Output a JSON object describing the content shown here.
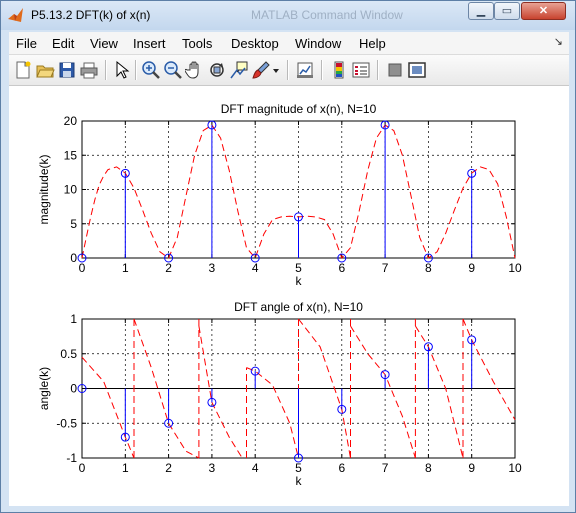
{
  "window": {
    "title": "P5.13.2 DFT(k) of x(n)",
    "background_window_title": "MATLAB Command Window",
    "controls": {
      "minimize": "▁",
      "maximize": "▭",
      "close": "✕"
    }
  },
  "menu": {
    "items": [
      "File",
      "Edit",
      "View",
      "Insert",
      "Tools",
      "Desktop",
      "Window",
      "Help"
    ],
    "dock_arrow": "↘"
  },
  "toolbar": {
    "icons": [
      "new-figure-icon",
      "open-file-icon",
      "save-icon",
      "print-icon",
      "pointer-icon",
      "zoom-in-icon",
      "zoom-out-icon",
      "pan-hand-icon",
      "rotate-3d-icon",
      "data-cursor-icon",
      "brush-icon",
      "brush-dropdown-icon",
      "link-plot-icon",
      "colorbar-icon",
      "legend-icon",
      "hide-plot-tools-icon",
      "show-plot-tools-icon"
    ]
  },
  "colors": {
    "stem": "#0000ff",
    "dashed": "#ff0000",
    "accent_title": "#c3d7ee"
  },
  "chart_data": [
    {
      "type": "stem",
      "title": "DFT magnitude of x(n), N=10",
      "xlabel": "k",
      "ylabel": "magnitude(k)",
      "xlim": [
        0,
        10
      ],
      "ylim": [
        0,
        20
      ],
      "xticks": [
        "0",
        "1",
        "2",
        "3",
        "4",
        "5",
        "6",
        "7",
        "8",
        "9",
        "10"
      ],
      "yticks": [
        "0",
        "5",
        "10",
        "15",
        "20"
      ],
      "grid": true,
      "stem": {
        "k": [
          0,
          1,
          2,
          3,
          4,
          5,
          6,
          7,
          8,
          9
        ],
        "values": [
          0,
          12.36,
          0,
          19.42,
          0,
          6.0,
          0,
          19.42,
          0,
          12.36
        ]
      },
      "continuous_dashed": {
        "description_free": true,
        "x": [
          0,
          0.1,
          0.2,
          0.3,
          0.4,
          0.5,
          0.6,
          0.8,
          1.0,
          1.2,
          1.4,
          1.6,
          1.8,
          2.0,
          2.2,
          2.4,
          2.6,
          2.8,
          3.0,
          3.2,
          3.4,
          3.6,
          3.8,
          4.0,
          4.2,
          4.4,
          4.6,
          4.8,
          5.0,
          5.2,
          5.4,
          5.6,
          5.8,
          6.0,
          6.2,
          6.4,
          6.6,
          6.8,
          7.0,
          7.2,
          7.4,
          7.6,
          7.8,
          8.0,
          8.2,
          8.4,
          8.6,
          8.8,
          9.0,
          9.2,
          9.4,
          9.6,
          9.8,
          10.0
        ],
        "y": [
          0,
          3.0,
          6.0,
          8.6,
          10.7,
          12.0,
          12.9,
          13.3,
          12.4,
          10.2,
          7.0,
          3.6,
          0.9,
          0,
          3.0,
          9.0,
          15.0,
          18.6,
          19.4,
          17.5,
          12.8,
          6.8,
          1.5,
          0,
          3.5,
          5.6,
          6.0,
          6.1,
          6.0,
          6.1,
          6.0,
          5.6,
          3.5,
          0,
          1.5,
          6.8,
          12.8,
          17.5,
          19.4,
          18.6,
          15.0,
          9.0,
          3.0,
          0,
          0.9,
          3.6,
          7.0,
          10.2,
          12.4,
          13.3,
          12.9,
          10.8,
          6.0,
          0
        ]
      }
    },
    {
      "type": "stem",
      "title": "DFT angle of x(n), N=10",
      "xlabel": "k",
      "ylabel": "angle(k)",
      "xlim": [
        0,
        10
      ],
      "ylim": [
        -1,
        1
      ],
      "xticks": [
        "0",
        "1",
        "2",
        "3",
        "4",
        "5",
        "6",
        "7",
        "8",
        "9",
        "10"
      ],
      "yticks": [
        "-1",
        "-0.5",
        "0",
        "0.5",
        "1"
      ],
      "grid": true,
      "stem": {
        "k": [
          0,
          1,
          2,
          3,
          4,
          5,
          6,
          7,
          8,
          9
        ],
        "values": [
          0,
          -0.7,
          -0.5,
          -0.2,
          0.25,
          -1.0,
          -0.3,
          0.2,
          0.6,
          0.7
        ]
      },
      "continuous_dashed": {
        "segments": [
          {
            "x": [
              0,
              0.5,
              1.0,
              1.2
            ],
            "y": [
              0.45,
              0.1,
              -0.7,
              -1.0
            ]
          },
          {
            "x": [
              1.2,
              1.2
            ],
            "y": [
              -1.0,
              1.0
            ]
          },
          {
            "x": [
              1.2,
              1.6,
              2.0,
              2.4,
              2.7
            ],
            "y": [
              1.0,
              0.3,
              -0.5,
              -0.9,
              -1.0
            ]
          },
          {
            "x": [
              2.7,
              2.7
            ],
            "y": [
              -1.0,
              1.0
            ]
          },
          {
            "x": [
              2.7,
              3.0,
              3.4,
              3.7
            ],
            "y": [
              0.9,
              -0.2,
              -0.7,
              -1.0
            ]
          },
          {
            "x": [
              3.7,
              3.7
            ],
            "y": [
              -1.0,
              -1.0
            ]
          },
          {
            "x": [
              3.8,
              3.8
            ],
            "y": [
              -1.0,
              0.3
            ]
          },
          {
            "x": [
              3.8,
              4.0,
              4.4,
              4.8,
              5.0
            ],
            "y": [
              0.3,
              0.25,
              0.05,
              -0.5,
              -1.0
            ]
          },
          {
            "x": [
              5.0,
              5.0
            ],
            "y": [
              -1.0,
              1.0
            ]
          },
          {
            "x": [
              5.0,
              5.5,
              6.0,
              6.2
            ],
            "y": [
              1.0,
              0.6,
              -0.3,
              -1.0
            ]
          },
          {
            "x": [
              6.2,
              6.2
            ],
            "y": [
              -1.0,
              1.0
            ]
          },
          {
            "x": [
              6.2,
              6.6,
              7.0,
              7.4,
              7.7
            ],
            "y": [
              0.9,
              0.5,
              0.2,
              -0.4,
              -1.0
            ]
          },
          {
            "x": [
              7.7,
              7.7
            ],
            "y": [
              -1.0,
              1.0
            ]
          },
          {
            "x": [
              7.7,
              8.0,
              8.4,
              8.8
            ],
            "y": [
              0.9,
              0.6,
              0.0,
              -1.0
            ]
          },
          {
            "x": [
              8.8,
              8.8
            ],
            "y": [
              -1.0,
              1.0
            ]
          },
          {
            "x": [
              8.8,
              9.0,
              9.5,
              10.0
            ],
            "y": [
              1.0,
              0.7,
              0.1,
              -0.45
            ]
          }
        ]
      }
    }
  ]
}
